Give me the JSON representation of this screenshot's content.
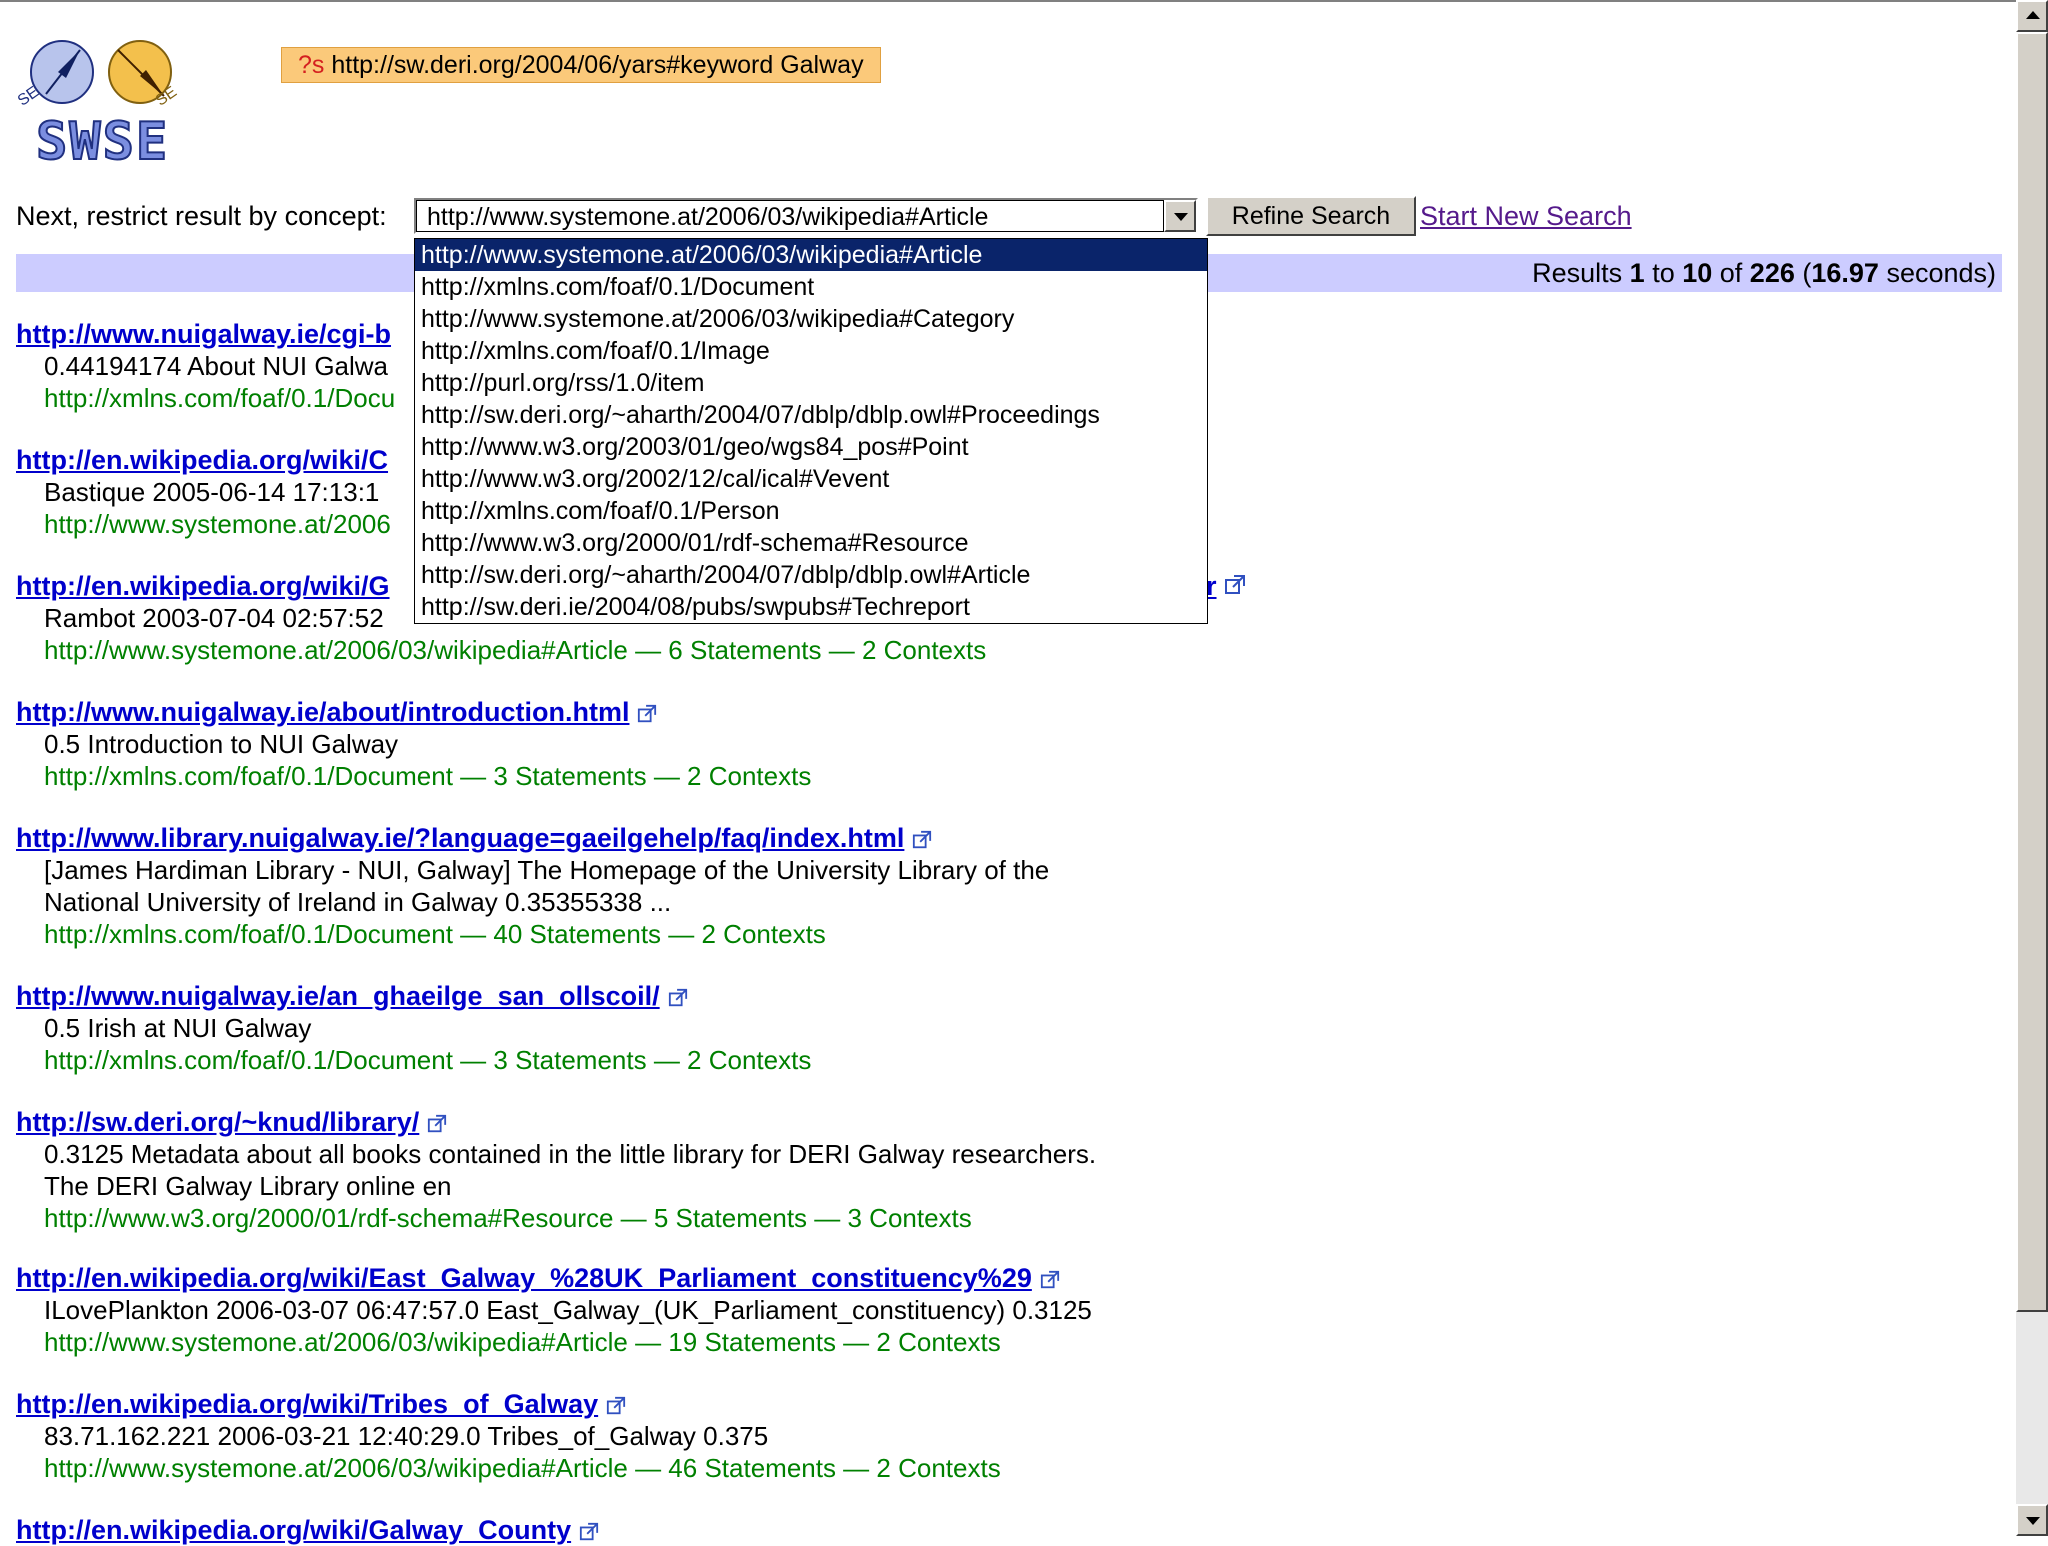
{
  "logo": {
    "text": "SWSE",
    "left_badge": "SE",
    "right_badge": "SE"
  },
  "query": {
    "variable": "?s",
    "text": "http://sw.deri.org/2004/06/yars#keyword Galway"
  },
  "restrict": {
    "label": "Next, restrict result by concept:",
    "selected": "http://www.systemone.at/2006/03/wikipedia#Article",
    "options": [
      "http://www.systemone.at/2006/03/wikipedia#Article",
      "http://xmlns.com/foaf/0.1/Document",
      "http://www.systemone.at/2006/03/wikipedia#Category",
      "http://xmlns.com/foaf/0.1/Image",
      "http://purl.org/rss/1.0/item",
      "http://sw.deri.org/~aharth/2004/07/dblp/dblp.owl#Proceedings",
      "http://www.w3.org/2003/01/geo/wgs84_pos#Point",
      "http://www.w3.org/2002/12/cal/ical#Vevent",
      "http://xmlns.com/foaf/0.1/Person",
      "http://www.w3.org/2000/01/rdf-schema#Resource",
      "http://sw.deri.org/~aharth/2004/07/dblp/dblp.owl#Article",
      "http://sw.deri.ie/2004/08/pubs/swpubs#Techreport"
    ],
    "refine_label": "Refine Search",
    "new_search_label": "Start New Search"
  },
  "results_summary": {
    "prefix": "Results ",
    "from": "1",
    "to_word": " to ",
    "to": "10",
    "of_word": " of ",
    "total": "226",
    "open_paren": " (",
    "seconds": "16.97",
    "suffix": " seconds)"
  },
  "results": [
    {
      "title": "http://www.nuigalway.ie/cgi-b",
      "snippet": "0.44194174 About NUI Galwa",
      "meta": "http://xmlns.com/foaf/0.1/Docu"
    },
    {
      "title": "http://en.wikipedia.org/wiki/C",
      "snippet": "Bastique 2005-06-14 17:13:1",
      "meta": "http://www.systemone.at/2006"
    },
    {
      "title": "http://en.wikipedia.org/wiki/G",
      "title_tail": "r",
      "snippet": "Rambot 2003-07-04 02:57:52",
      "meta": "http://www.systemone.at/2006/03/wikipedia#Article — 6 Statements — 2 Contexts"
    },
    {
      "title": "http://www.nuigalway.ie/about/introduction.html",
      "snippet": "0.5 Introduction to NUI Galway",
      "meta": "http://xmlns.com/foaf/0.1/Document — 3 Statements — 2 Contexts"
    },
    {
      "title": "http://www.library.nuigalway.ie/?language=gaeilgehelp/faq/index.html",
      "snippet": "[James Hardiman Library - NUI, Galway] The Homepage of the University Library of the",
      "snippet2": "National University of Ireland in Galway 0.35355338 ...",
      "meta": "http://xmlns.com/foaf/0.1/Document — 40 Statements — 2 Contexts"
    },
    {
      "title": "http://www.nuigalway.ie/an_ghaeilge_san_ollscoil/",
      "snippet": "0.5 Irish at NUI Galway",
      "meta": "http://xmlns.com/foaf/0.1/Document — 3 Statements — 2 Contexts"
    },
    {
      "title": "http://sw.deri.org/~knud/library/",
      "snippet": "0.3125 Metadata about all books contained in the little library for DERI Galway researchers.",
      "snippet2": "The DERI Galway Library online en",
      "meta": "http://www.w3.org/2000/01/rdf-schema#Resource — 5 Statements — 3 Contexts"
    },
    {
      "title": "http://en.wikipedia.org/wiki/East_Galway_%28UK_Parliament_constituency%29",
      "snippet": "ILovePlankton 2006-03-07 06:47:57.0 East_Galway_(UK_Parliament_constituency) 0.3125",
      "meta": "http://www.systemone.at/2006/03/wikipedia#Article — 19 Statements — 2 Contexts"
    },
    {
      "title": "http://en.wikipedia.org/wiki/Tribes_of_Galway",
      "snippet": "83.71.162.221 2006-03-21 12:40:29.0 Tribes_of_Galway 0.375",
      "meta": "http://www.systemone.at/2006/03/wikipedia#Article — 46 Statements — 2 Contexts"
    },
    {
      "title": "http://en.wikipedia.org/wiki/Galway_County"
    }
  ]
}
